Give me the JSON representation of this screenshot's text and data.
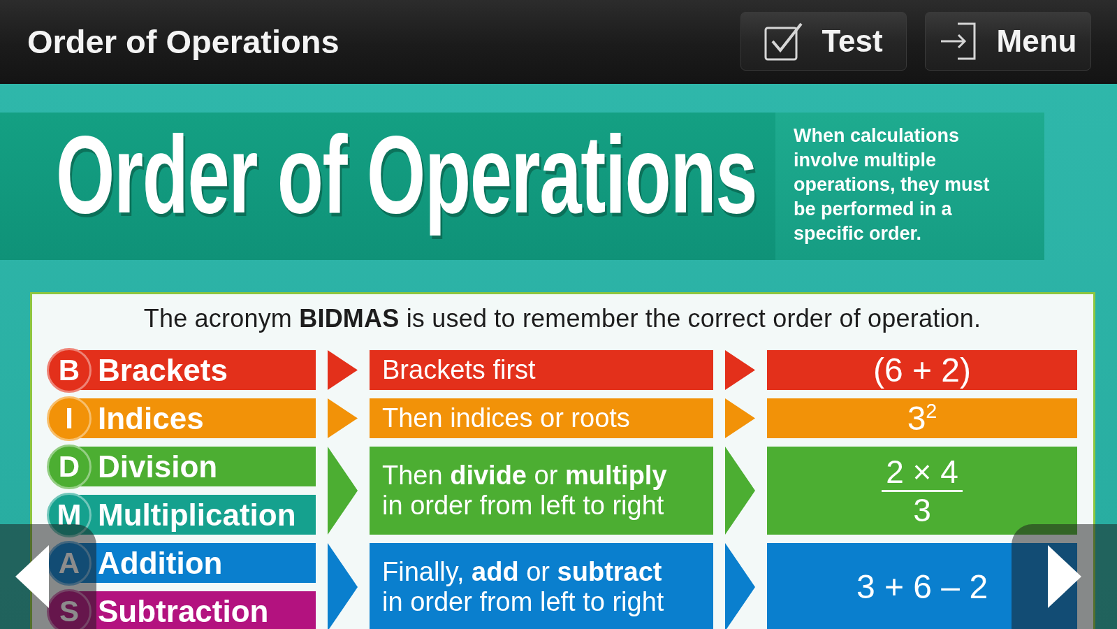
{
  "top_bar": {
    "title": "Order of Operations",
    "buttons": [
      {
        "kind": "test",
        "label": "Test"
      },
      {
        "kind": "menu",
        "label": "Menu"
      }
    ]
  },
  "banner": {
    "title": "Order of Operations",
    "description": "When calculations involve multiple operations, they must be performed in a specific order."
  },
  "card": {
    "intro": "The acronym **BIDMAS** is used to remember the correct order of operation.",
    "groups": [
      {
        "color": "#e3301b",
        "steps": [
          {
            "letter": "B",
            "name": "Brackets",
            "color": "#e3301b"
          }
        ],
        "rule": "Brackets first",
        "example": {
          "kind": "text",
          "text": "(6 + 2)"
        }
      },
      {
        "color": "#f29208",
        "steps": [
          {
            "letter": "I",
            "name": "Indices",
            "color": "#f29208"
          }
        ],
        "rule": "Then indices or roots",
        "example": {
          "kind": "text",
          "text": "3$^{2}$"
        }
      },
      {
        "color": "#4cae32",
        "steps": [
          {
            "letter": "D",
            "name": "Division",
            "color": "#4cae32"
          },
          {
            "letter": "M",
            "name": "Multiplication",
            "color": "#15a18e"
          }
        ],
        "rule": "Then **divide** or **multiply** in order from left to right",
        "example": {
          "kind": "fraction",
          "numerator": "2 × 4",
          "denominator": "3"
        }
      },
      {
        "color": "#0a7fce",
        "steps": [
          {
            "letter": "A",
            "name": "Addition",
            "color": "#0a7fce"
          },
          {
            "letter": "S",
            "name": "Subtraction",
            "color": "#b3127f"
          }
        ],
        "rule": "Finally, **add** or **subtract** in order from left to right",
        "example": {
          "kind": "text",
          "text": "3 + 6 – 2"
        }
      }
    ]
  }
}
